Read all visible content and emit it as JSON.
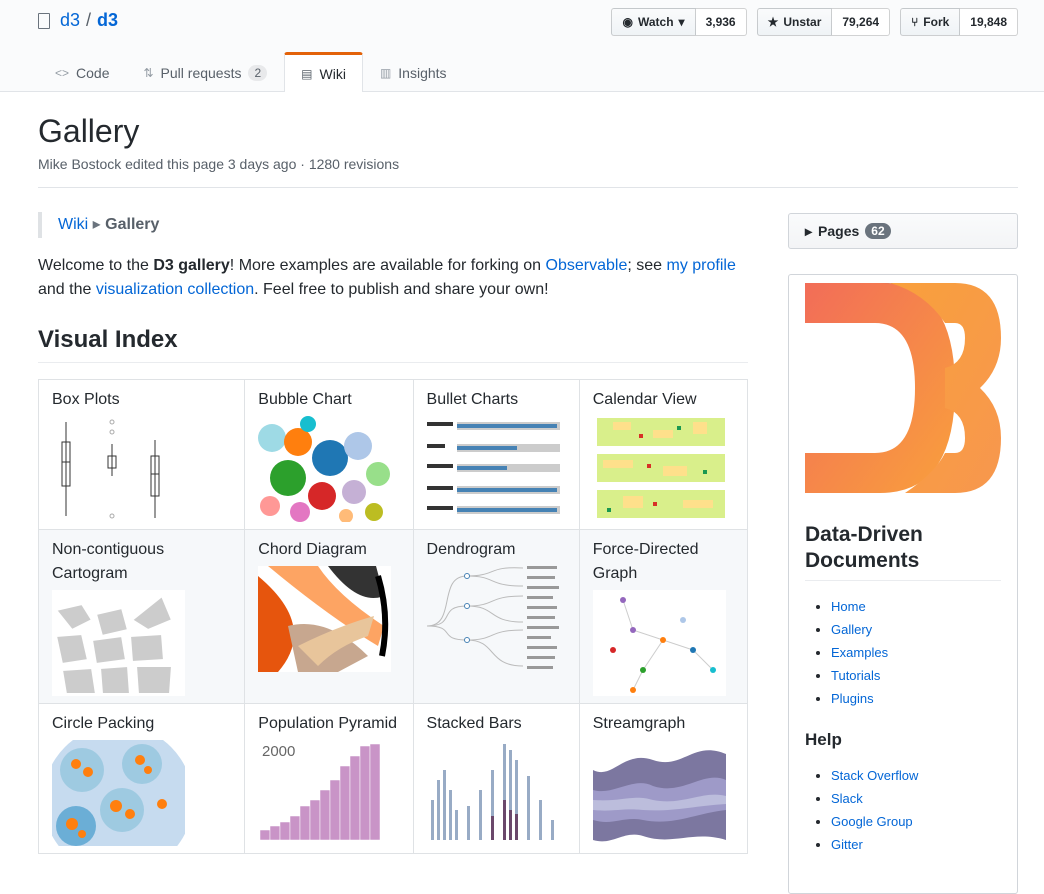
{
  "repo": {
    "owner": "d3",
    "sep": "/",
    "name": "d3"
  },
  "buttons": [
    {
      "label": "Watch",
      "count": "3,936",
      "icon": "eye-icon"
    },
    {
      "label": "Unstar",
      "count": "79,264",
      "icon": "star-icon"
    },
    {
      "label": "Fork",
      "count": "19,848",
      "icon": "fork-icon"
    }
  ],
  "tabs": [
    {
      "label": "Code",
      "icon": "code-icon"
    },
    {
      "label": "Pull requests",
      "count": "2",
      "icon": "pr-icon"
    },
    {
      "label": "Wiki",
      "icon": "book-icon",
      "selected": true
    },
    {
      "label": "Insights",
      "icon": "graph-icon"
    }
  ],
  "page": {
    "title": "Gallery",
    "meta": "Mike Bostock edited this page 3 days ago · 1280 revisions"
  },
  "breadcrumb": {
    "wiki": "Wiki",
    "arrow": "▸",
    "current": "Gallery"
  },
  "welcome": {
    "t1": "Welcome to the ",
    "bold": "D3 gallery",
    "t2": "! More examples are available for forking on ",
    "link1": "Observable",
    "t3": "; see ",
    "link2": "my profile",
    "t4": "and the ",
    "link3": "visualization collection",
    "t5": ". Feel free to publish and share your own!"
  },
  "visual_index": {
    "heading": "Visual Index",
    "items": [
      "Box Plots",
      "Bubble Chart",
      "Bullet Charts",
      "Calendar View",
      "Non-contiguous Cartogram",
      "Chord Diagram",
      "Dendrogram",
      "Force-Directed Graph",
      "Circle Packing",
      "Population Pyramid",
      "Stacked Bars",
      "Streamgraph"
    ],
    "pyramid_year": "2000"
  },
  "sidebar": {
    "pages_label": "Pages",
    "pages_count": "62",
    "title": "Data-Driven Documents",
    "links": [
      "Home",
      "Gallery",
      "Examples",
      "Tutorials",
      "Plugins"
    ],
    "help_title": "Help",
    "help_links": [
      "Stack Overflow",
      "Slack",
      "Google Group",
      "Gitter"
    ]
  },
  "colors": {
    "accent": "#e36209",
    "link": "#0366d6"
  }
}
